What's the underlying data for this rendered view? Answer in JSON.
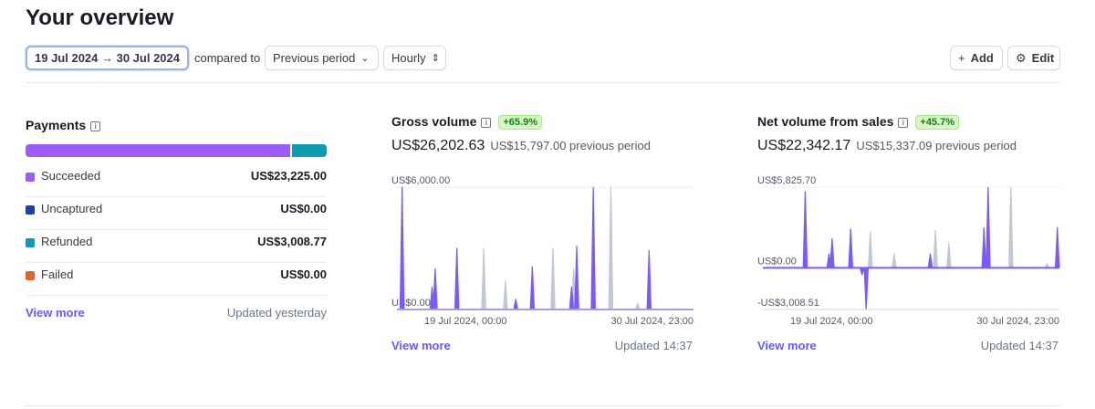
{
  "page": {
    "title": "Your overview"
  },
  "toolbar": {
    "date_range": "19 Jul 2024 → 30 Jul 2024",
    "compared_to": "compared to",
    "period": "Previous period",
    "granularity": "Hourly",
    "add": "Add",
    "edit": "Edit"
  },
  "payments": {
    "title": "Payments",
    "rows": [
      {
        "label": "Succeeded",
        "value": "US$23,225.00",
        "color": "#9e5cf7"
      },
      {
        "label": "Uncaptured",
        "value": "US$0.00",
        "color": "#1f3fa3"
      },
      {
        "label": "Refunded",
        "value": "US$3,008.77",
        "color": "#0e9cb2"
      },
      {
        "label": "Failed",
        "value": "US$0.00",
        "color": "#e5622a"
      }
    ],
    "view_more": "View more",
    "updated": "Updated yesterday"
  },
  "gross": {
    "title": "Gross volume",
    "badge": "+65.9%",
    "amount": "US$26,202.63",
    "previous": "US$15,797.00 previous period",
    "view_more": "View more",
    "updated": "Updated 14:37"
  },
  "net": {
    "title": "Net volume from sales",
    "badge": "+45.7%",
    "amount": "US$22,342.17",
    "previous": "US$15,337.09 previous period",
    "view_more": "View more",
    "updated": "Updated 14:37"
  },
  "chart_data": [
    {
      "type": "line",
      "title": "Gross volume",
      "y_ticks": [
        "US$6,000.00",
        "US$0.00"
      ],
      "ylim": [
        0,
        6000
      ],
      "x_ticks": [
        "19 Jul 2024, 00:00",
        "30 Jul 2024, 23:00"
      ],
      "x_range": [
        0,
        287
      ],
      "series": [
        {
          "color": "#7a5af8",
          "spikes": [
            [
              5,
              6000
            ],
            [
              34,
              1100
            ],
            [
              37,
              2000
            ],
            [
              58,
              3000
            ],
            [
              115,
              500
            ],
            [
              131,
              2100
            ],
            [
              169,
              1100
            ],
            [
              174,
              3100
            ],
            [
              190,
              6000
            ],
            [
              244,
              2900
            ]
          ]
        },
        {
          "color": "#c0c8d2",
          "spikes": [
            [
              84,
              3000
            ],
            [
              105,
              1400
            ],
            [
              151,
              3000
            ],
            [
              171,
              2000
            ],
            [
              207,
              6000
            ],
            [
              233,
              300
            ]
          ]
        }
      ]
    },
    {
      "type": "line",
      "title": "Net volume from sales",
      "y_ticks": [
        "US$5,825.70",
        "US$0.00",
        "-US$3,008.51"
      ],
      "ylim": [
        -3008.51,
        5825.7
      ],
      "x_ticks": [
        "19 Jul 2024, 00:00",
        "30 Jul 2024, 23:00"
      ],
      "x_range": [
        0,
        287
      ],
      "series": [
        {
          "color": "#7a5af8",
          "spikes": [
            [
              41,
              5500
            ],
            [
              64,
              1000
            ],
            [
              67,
              2100
            ],
            [
              85,
              2800
            ],
            [
              96,
              -500
            ],
            [
              100,
              -3008.51
            ],
            [
              162,
              1000
            ],
            [
              214,
              2900
            ],
            [
              218,
              5800
            ],
            [
              285,
              2900
            ]
          ]
        },
        {
          "color": "#c0c8d2",
          "spikes": [
            [
              104,
              2600
            ],
            [
              127,
              1000
            ],
            [
              167,
              2700
            ],
            [
              180,
              1800
            ],
            [
              240,
              5800
            ],
            [
              275,
              300
            ]
          ]
        }
      ]
    }
  ]
}
